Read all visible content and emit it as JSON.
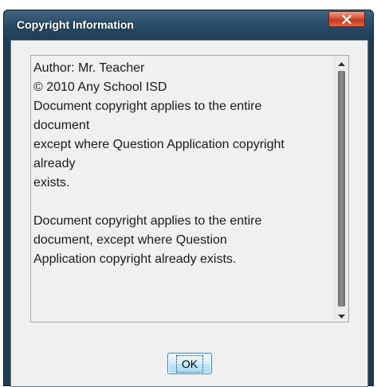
{
  "window": {
    "title": "Copyright Information"
  },
  "content": {
    "lines": [
      "Author: Mr. Teacher",
      "© 2010 Any School ISD",
      "Document copyright applies to the entire",
      "document",
      "except where Question Application copyright",
      "already",
      "exists.",
      "",
      "Document copyright applies to the entire",
      "document, except where Question",
      "Application copyright already exists."
    ]
  },
  "buttons": {
    "ok_label": "OK",
    "close_icon": "close-icon"
  },
  "colors": {
    "titlebar": "#2b4d68",
    "close_button": "#c23a1e",
    "dialog_background": "#f0f0f0",
    "ok_button": "#bee6fd"
  }
}
